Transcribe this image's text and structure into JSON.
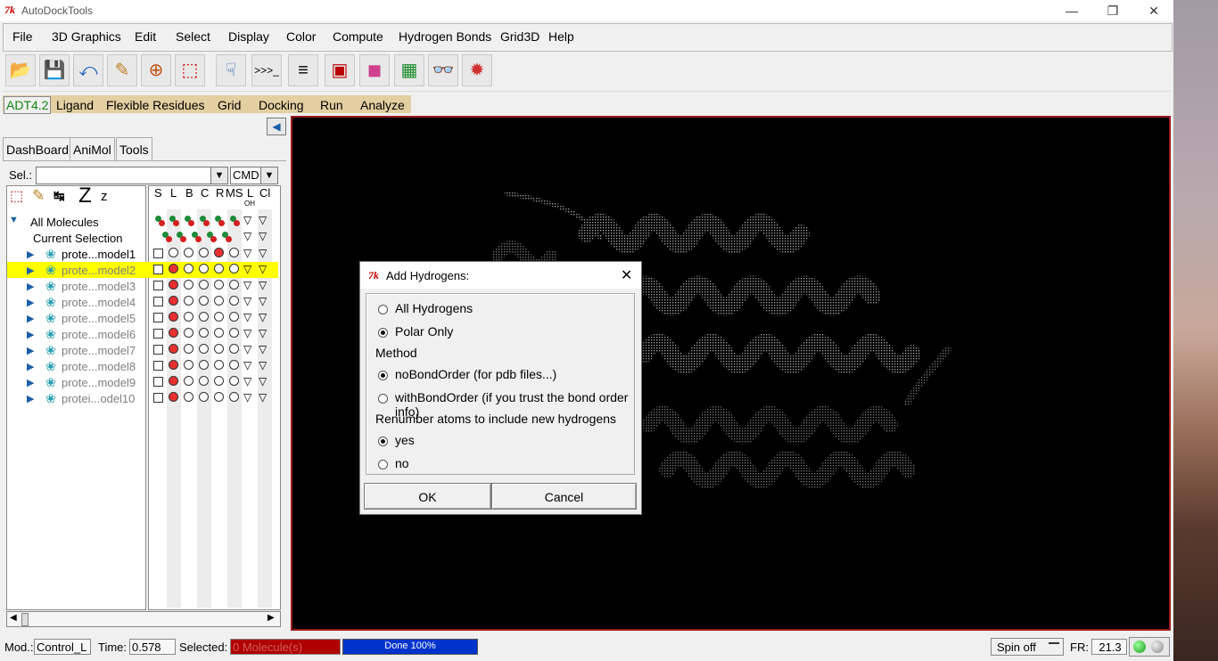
{
  "window": {
    "title": "AutoDockTools",
    "tk_logo": "7k"
  },
  "menubar": {
    "items": [
      "File",
      "3D Graphics",
      "Edit",
      "Select",
      "Display",
      "Color",
      "Compute",
      "Hydrogen Bonds",
      "Grid3D",
      "Help"
    ]
  },
  "toolbar": {
    "icons": [
      "open-molecule-icon",
      "save-icon",
      "undo-icon",
      "pencil-icon",
      "crosshair-icon",
      "select-icon",
      "pointer-icon",
      "python-shell-icon",
      "text-panel-icon",
      "console-icon",
      "color-cube-icon",
      "network-icon",
      "stereo-glasses-icon",
      "cpk-icon"
    ]
  },
  "adt_tabs": {
    "active": "ADT4.2",
    "items": [
      "Ligand",
      "Flexible Residues",
      "Grid",
      "Docking",
      "Run",
      "Analyze"
    ]
  },
  "left_panel": {
    "tabs": [
      "DashBoard",
      "AniMol",
      "Tools"
    ],
    "sel_label": "Sel.:",
    "cmd_value": "CMD",
    "tool_glyphs": [
      "Z",
      "z"
    ],
    "column_headers": [
      "S",
      "L",
      "B",
      "C",
      "R",
      "MS",
      "L",
      "Cl"
    ],
    "column_subheaders": [
      "OH"
    ],
    "tree": {
      "root": "All Molecules",
      "current_selection": "Current Selection",
      "molecules": [
        "prote...model1",
        "prote...model2",
        "prote...model3",
        "prote...model4",
        "prote...model5",
        "prote...model6",
        "prote...model7",
        "prote...model8",
        "prote...model9",
        "protei...odel10"
      ],
      "selected_index": 1
    }
  },
  "dialog": {
    "title": "Add Hydrogens:",
    "options_hydrogens": [
      "All Hydrogens",
      "Polar Only"
    ],
    "hydrogens_selected": 1,
    "method_label": "Method",
    "options_method": [
      "noBondOrder (for pdb files...)",
      "withBondOrder (if you trust the bond order info)"
    ],
    "method_selected": 0,
    "renumber_label": "Renumber atoms to include new hydrogens",
    "options_renumber": [
      "yes",
      "no"
    ],
    "renumber_selected": 0,
    "ok_label": "OK",
    "cancel_label": "Cancel"
  },
  "statusbar": {
    "mod_label": "Mod.:",
    "mod_value": "Control_L",
    "time_label": "Time:",
    "time_value": "0.578",
    "selected_label": "Selected:",
    "selected_value": "0 Molecule(s)",
    "progress_text": "Done 100%",
    "progress_fraction": 1.0,
    "spin_label": "Spin off",
    "fr_label": "FR:",
    "fr_value": "21.3"
  },
  "colors": {
    "viewer_border": "#9b1c1c",
    "selection_highlight": "#ffff00",
    "progress": "#0033cc",
    "selected_field": "#b00000",
    "adt_tab_bg": "#e3cfa1"
  }
}
